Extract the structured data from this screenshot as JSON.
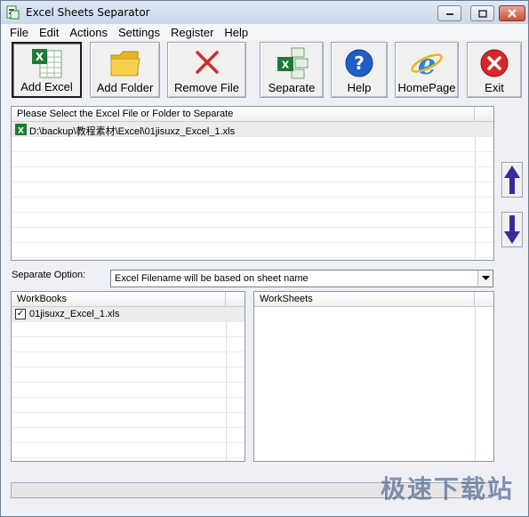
{
  "window": {
    "title": "Excel Sheets Separator"
  },
  "menu": [
    "File",
    "Edit",
    "Actions",
    "Settings",
    "Register",
    "Help"
  ],
  "toolbar": {
    "add_excel": "Add Excel",
    "add_folder": "Add Folder",
    "remove_file": "Remove File",
    "separate": "Separate",
    "help": "Help",
    "homepage": "HomePage",
    "exit": "Exit"
  },
  "file_list": {
    "header": "Please Select the Excel File or Folder to Separate",
    "items": [
      "D:\\backup\\教程素材\\Excel\\01jisuxz_Excel_1.xls"
    ]
  },
  "separate_option": {
    "label": "Separate Option:",
    "selected": "Excel Filename will be based on sheet name"
  },
  "workbooks": {
    "header": "WorkBooks",
    "items": [
      {
        "name": "01jisuxz_Excel_1.xls",
        "checked": true
      }
    ]
  },
  "worksheets": {
    "header": "WorkSheets"
  },
  "watermark": "极速下载站",
  "colors": {
    "accent_arrow": "#3b2a9a",
    "exit_red": "#d8262b",
    "ie_blue": "#2b86d6"
  }
}
